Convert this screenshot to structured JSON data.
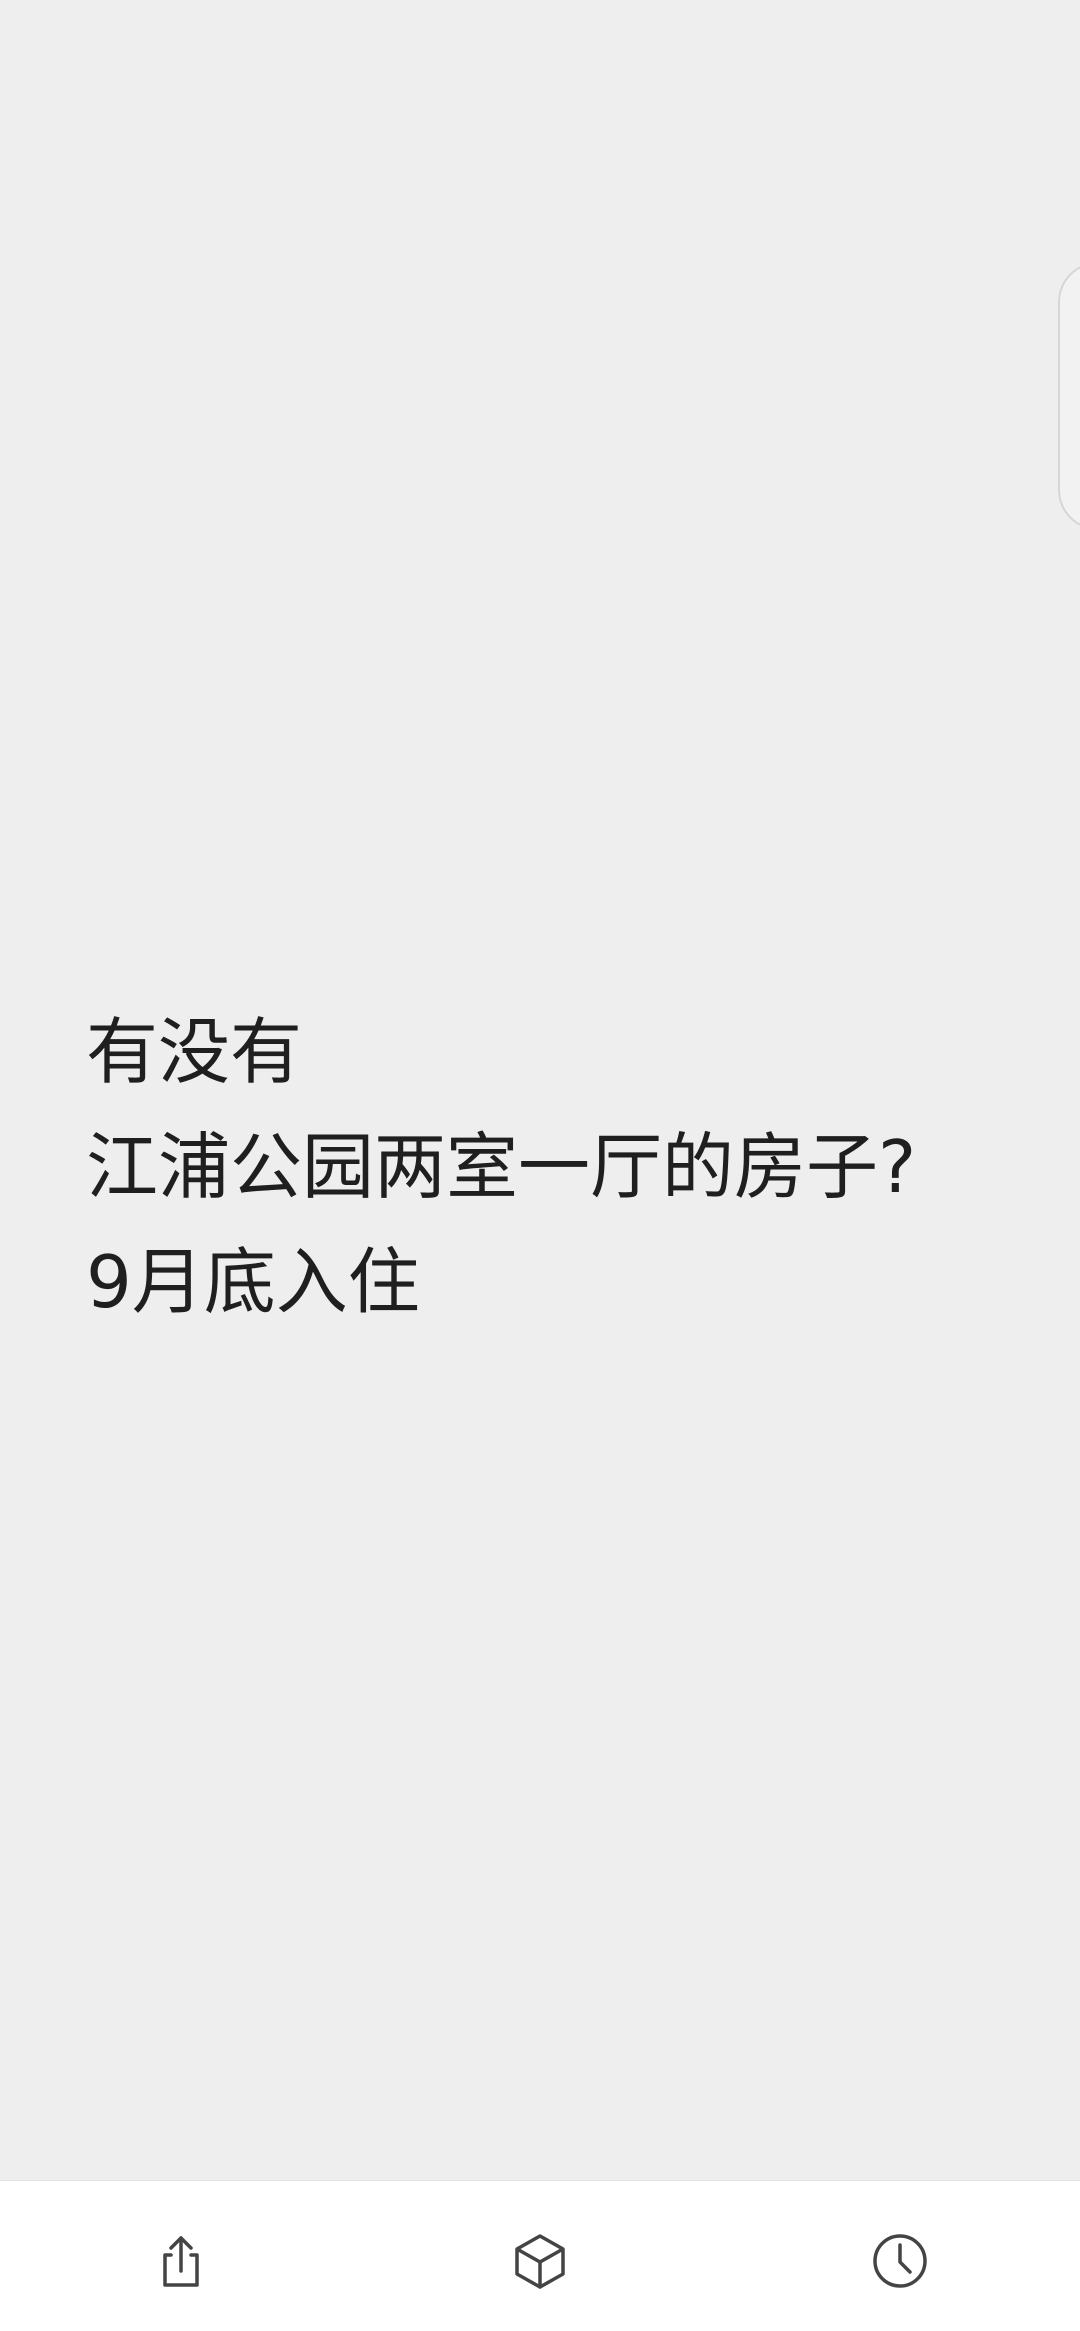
{
  "note": {
    "lines": [
      "有没有",
      "江浦公园两室一厅的房子?",
      "9月底入住"
    ]
  },
  "toolbar": {
    "buttons": [
      {
        "icon": "share-icon"
      },
      {
        "icon": "cube-icon"
      },
      {
        "icon": "clock-icon"
      }
    ]
  },
  "colors": {
    "background": "#eeeeee",
    "text": "#1f1f1f",
    "toolbar_background": "#ffffff",
    "icon": "#444444"
  }
}
